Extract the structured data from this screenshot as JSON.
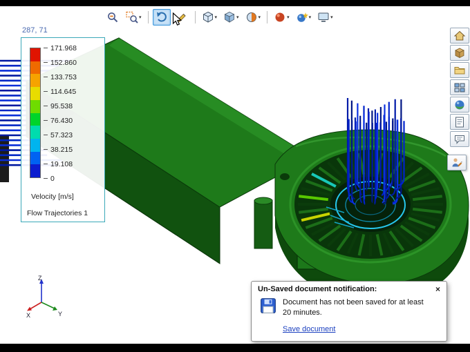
{
  "viewport": {
    "coords": "287, 71"
  },
  "legend": {
    "title": "Velocity [m/s]",
    "plot_name": "Flow Trajectories 1",
    "ticks": [
      "171.968",
      "152.860",
      "133.753",
      "114.645",
      "95.538",
      "76.430",
      "57.323",
      "38.215",
      "19.108",
      "0"
    ],
    "band_colors": [
      "#e01400",
      "#ef6a00",
      "#f6a300",
      "#e8dc00",
      "#6fdc00",
      "#00d42a",
      "#00dcae",
      "#00b4ef",
      "#0063f2",
      "#0c1ecf"
    ]
  },
  "top_toolbar": {
    "items": [
      {
        "name": "zoom-to-fit",
        "icon": "zoomFit",
        "dropdown": false,
        "active": false
      },
      {
        "name": "zoom-to-area",
        "icon": "zoomArea",
        "dropdown": true,
        "active": false
      },
      {
        "type": "separator"
      },
      {
        "name": "previous-view",
        "icon": "prevView",
        "dropdown": false,
        "active": true
      },
      {
        "name": "sketch-tool",
        "icon": "pencil",
        "dropdown": false,
        "active": false
      },
      {
        "type": "separator"
      },
      {
        "name": "view-orientation",
        "icon": "orientCube",
        "dropdown": true,
        "active": false
      },
      {
        "name": "display-style",
        "icon": "shadedCube",
        "dropdown": true,
        "active": false
      },
      {
        "name": "section-view",
        "icon": "section",
        "dropdown": true,
        "active": false
      },
      {
        "type": "separator"
      },
      {
        "name": "edit-appearance",
        "icon": "appearanceBall",
        "dropdown": true,
        "active": false
      },
      {
        "name": "apply-scene",
        "icon": "sceneBall",
        "dropdown": true,
        "active": false
      },
      {
        "name": "view-settings",
        "icon": "monitor",
        "dropdown": true,
        "active": false
      }
    ]
  },
  "right_toolbar": {
    "items": [
      {
        "name": "home",
        "icon": "home"
      },
      {
        "name": "design-library",
        "icon": "box3d"
      },
      {
        "name": "file-explorer",
        "icon": "folder"
      },
      {
        "name": "view-palette",
        "icon": "grid"
      },
      {
        "name": "appearances-scenes",
        "icon": "sphere"
      },
      {
        "name": "custom-properties",
        "icon": "props"
      },
      {
        "name": "forum",
        "icon": "bubble"
      }
    ],
    "detached": {
      "name": "markup",
      "icon": "personPencil"
    }
  },
  "notification": {
    "title": "Un-Saved document notification:",
    "close_glyph": "×",
    "message": "Document has not been saved for at least 20 minutes.",
    "link": "Save document"
  },
  "triad": {
    "x": "X",
    "y": "Y",
    "z": "Z"
  }
}
